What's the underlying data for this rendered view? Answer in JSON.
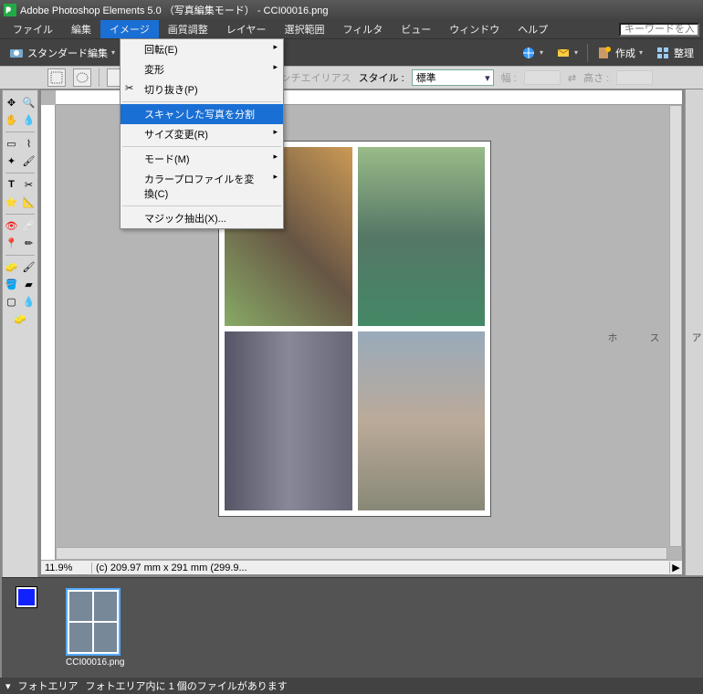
{
  "title": "Adobe Photoshop Elements 5.0 （写真編集モード） - CCI00016.png",
  "menubar": [
    "ファイル",
    "編集",
    "イメージ",
    "画質調整",
    "レイヤー",
    "選択範囲",
    "フィルタ",
    "ビュー",
    "ウィンドウ",
    "ヘルプ"
  ],
  "menubar_active_index": 2,
  "search_placeholder": "キーワードを入力",
  "toolbar": {
    "mode": "スタンダード編集",
    "create": "作成",
    "organize": "整理"
  },
  "options": {
    "antialias": "アンチエイリアス",
    "style_label": "スタイル :",
    "style_value": "標準",
    "width_label": "幅 :",
    "height_label": "高さ :"
  },
  "dropdown": {
    "items": [
      {
        "label": "回転(E)",
        "arrow": true
      },
      {
        "label": "変形",
        "arrow": true
      },
      {
        "label": "切り抜き(P)",
        "icon": "crop"
      },
      {
        "label": "スキャンした写真を分割",
        "highlight": true
      },
      {
        "label": "サイズ変更(R)",
        "arrow": true
      },
      {
        "label": "モード(M)",
        "arrow": true
      },
      {
        "label": "カラープロファイルを変換(C)",
        "arrow": true
      },
      {
        "label": "マジック抽出(X)..."
      }
    ],
    "separators_after": [
      2,
      4,
      6
    ]
  },
  "zoom": "11.9%",
  "dimensions": "(c) 209.97 mm x 291 mm (299.9...",
  "thumb_filename": "CCI00016.png",
  "statusbar": {
    "area": "フォトエリア",
    "msg": "フォトエリア内に 1 個のファイルがあります"
  },
  "swatch_fg": "#1122ff",
  "right_tabs": [
    "ア",
    "ス",
    "ホ"
  ]
}
